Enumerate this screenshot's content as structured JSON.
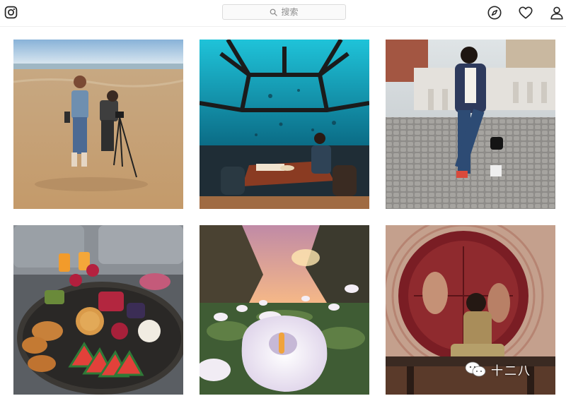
{
  "header": {
    "logo_icon": "camera-glyph-icon",
    "search": {
      "icon": "search-icon",
      "placeholder": "搜索"
    },
    "nav_icons": [
      "compass-icon",
      "heart-icon",
      "person-icon"
    ]
  },
  "feed": {
    "posts": [
      {
        "id": "post-1",
        "content": "beach-photographers-photo"
      },
      {
        "id": "post-2",
        "content": "underwater-restaurant-photo"
      },
      {
        "id": "post-3",
        "content": "street-fashion-photo"
      },
      {
        "id": "post-4",
        "content": "brunch-table-photo"
      },
      {
        "id": "post-5",
        "content": "calla-lily-valley-photo"
      },
      {
        "id": "post-6",
        "content": "woman-in-circular-mural-photo"
      }
    ]
  },
  "watermark": {
    "icon": "wechat-icon",
    "text": "十二八"
  },
  "colors": {
    "border": "#dbdbdb",
    "search_bg": "#fafafa",
    "placeholder": "#8e8e8e",
    "icon": "#262626"
  }
}
